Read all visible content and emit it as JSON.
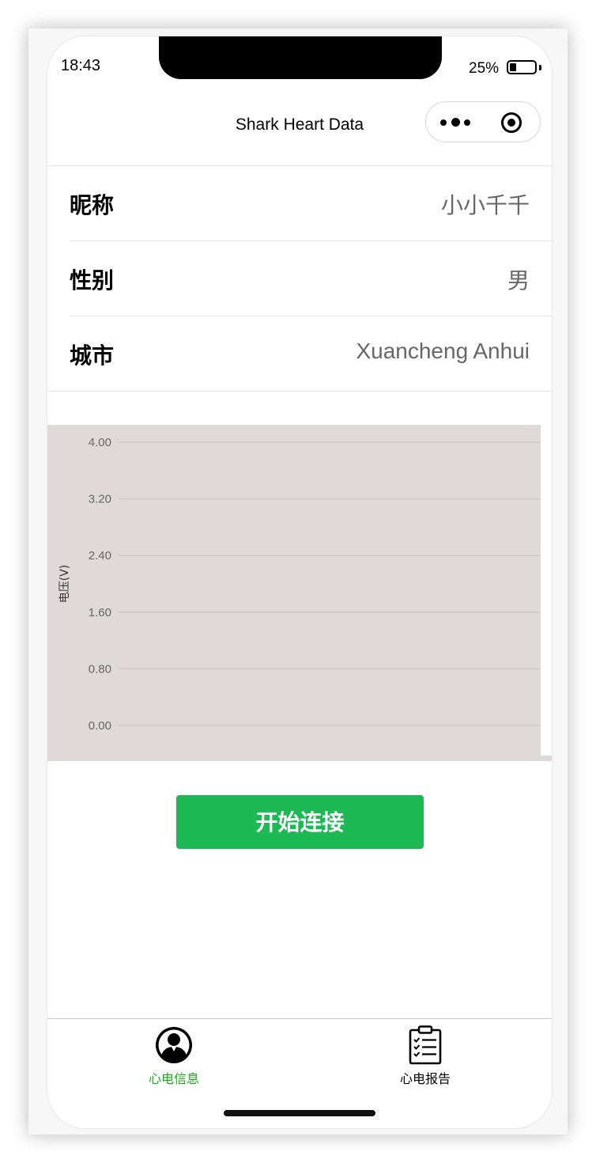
{
  "status": {
    "time": "18:43",
    "battery_percent": "25%",
    "battery_level": 0.25
  },
  "nav": {
    "title": "Shark Heart Data"
  },
  "profile": {
    "rows": [
      {
        "label": "昵称",
        "value": "小小千千"
      },
      {
        "label": "性别",
        "value": "男"
      },
      {
        "label": "城市",
        "value": "Xuancheng Anhui"
      }
    ]
  },
  "chart_data": {
    "type": "line",
    "ylabel": "电压(V)",
    "xlabel": "",
    "ylim": [
      0,
      4
    ],
    "yticks": [
      "4.00",
      "3.20",
      "2.40",
      "1.60",
      "0.80",
      "0.00"
    ],
    "grid": true,
    "series": [],
    "background": "#e0d9da"
  },
  "actions": {
    "connect_label": "开始连接"
  },
  "tabbar": {
    "tabs": [
      {
        "label": "心电信息",
        "icon": "user-avatar-icon",
        "active": true
      },
      {
        "label": "心电报告",
        "icon": "clipboard-checklist-icon",
        "active": false
      }
    ]
  },
  "colors": {
    "accent": "#1db954",
    "tab_active": "#1aad19",
    "tab_inactive": "#000000",
    "chart_bg": "#e0d9da"
  }
}
